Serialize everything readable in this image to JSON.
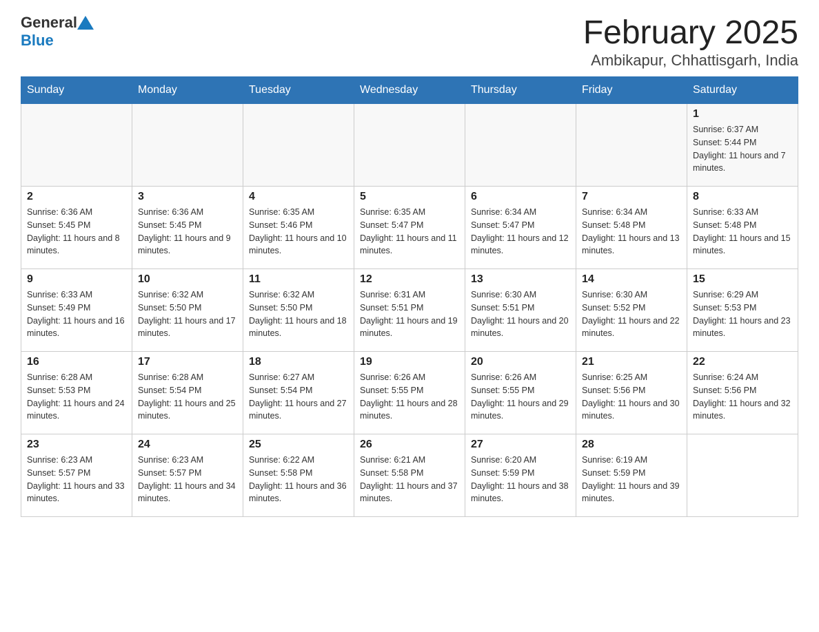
{
  "logo": {
    "general": "General",
    "blue": "Blue"
  },
  "header": {
    "title": "February 2025",
    "location": "Ambikapur, Chhattisgarh, India"
  },
  "weekdays": [
    "Sunday",
    "Monday",
    "Tuesday",
    "Wednesday",
    "Thursday",
    "Friday",
    "Saturday"
  ],
  "weeks": [
    [
      {
        "day": "",
        "info": ""
      },
      {
        "day": "",
        "info": ""
      },
      {
        "day": "",
        "info": ""
      },
      {
        "day": "",
        "info": ""
      },
      {
        "day": "",
        "info": ""
      },
      {
        "day": "",
        "info": ""
      },
      {
        "day": "1",
        "info": "Sunrise: 6:37 AM\nSunset: 5:44 PM\nDaylight: 11 hours and 7 minutes."
      }
    ],
    [
      {
        "day": "2",
        "info": "Sunrise: 6:36 AM\nSunset: 5:45 PM\nDaylight: 11 hours and 8 minutes."
      },
      {
        "day": "3",
        "info": "Sunrise: 6:36 AM\nSunset: 5:45 PM\nDaylight: 11 hours and 9 minutes."
      },
      {
        "day": "4",
        "info": "Sunrise: 6:35 AM\nSunset: 5:46 PM\nDaylight: 11 hours and 10 minutes."
      },
      {
        "day": "5",
        "info": "Sunrise: 6:35 AM\nSunset: 5:47 PM\nDaylight: 11 hours and 11 minutes."
      },
      {
        "day": "6",
        "info": "Sunrise: 6:34 AM\nSunset: 5:47 PM\nDaylight: 11 hours and 12 minutes."
      },
      {
        "day": "7",
        "info": "Sunrise: 6:34 AM\nSunset: 5:48 PM\nDaylight: 11 hours and 13 minutes."
      },
      {
        "day": "8",
        "info": "Sunrise: 6:33 AM\nSunset: 5:48 PM\nDaylight: 11 hours and 15 minutes."
      }
    ],
    [
      {
        "day": "9",
        "info": "Sunrise: 6:33 AM\nSunset: 5:49 PM\nDaylight: 11 hours and 16 minutes."
      },
      {
        "day": "10",
        "info": "Sunrise: 6:32 AM\nSunset: 5:50 PM\nDaylight: 11 hours and 17 minutes."
      },
      {
        "day": "11",
        "info": "Sunrise: 6:32 AM\nSunset: 5:50 PM\nDaylight: 11 hours and 18 minutes."
      },
      {
        "day": "12",
        "info": "Sunrise: 6:31 AM\nSunset: 5:51 PM\nDaylight: 11 hours and 19 minutes."
      },
      {
        "day": "13",
        "info": "Sunrise: 6:30 AM\nSunset: 5:51 PM\nDaylight: 11 hours and 20 minutes."
      },
      {
        "day": "14",
        "info": "Sunrise: 6:30 AM\nSunset: 5:52 PM\nDaylight: 11 hours and 22 minutes."
      },
      {
        "day": "15",
        "info": "Sunrise: 6:29 AM\nSunset: 5:53 PM\nDaylight: 11 hours and 23 minutes."
      }
    ],
    [
      {
        "day": "16",
        "info": "Sunrise: 6:28 AM\nSunset: 5:53 PM\nDaylight: 11 hours and 24 minutes."
      },
      {
        "day": "17",
        "info": "Sunrise: 6:28 AM\nSunset: 5:54 PM\nDaylight: 11 hours and 25 minutes."
      },
      {
        "day": "18",
        "info": "Sunrise: 6:27 AM\nSunset: 5:54 PM\nDaylight: 11 hours and 27 minutes."
      },
      {
        "day": "19",
        "info": "Sunrise: 6:26 AM\nSunset: 5:55 PM\nDaylight: 11 hours and 28 minutes."
      },
      {
        "day": "20",
        "info": "Sunrise: 6:26 AM\nSunset: 5:55 PM\nDaylight: 11 hours and 29 minutes."
      },
      {
        "day": "21",
        "info": "Sunrise: 6:25 AM\nSunset: 5:56 PM\nDaylight: 11 hours and 30 minutes."
      },
      {
        "day": "22",
        "info": "Sunrise: 6:24 AM\nSunset: 5:56 PM\nDaylight: 11 hours and 32 minutes."
      }
    ],
    [
      {
        "day": "23",
        "info": "Sunrise: 6:23 AM\nSunset: 5:57 PM\nDaylight: 11 hours and 33 minutes."
      },
      {
        "day": "24",
        "info": "Sunrise: 6:23 AM\nSunset: 5:57 PM\nDaylight: 11 hours and 34 minutes."
      },
      {
        "day": "25",
        "info": "Sunrise: 6:22 AM\nSunset: 5:58 PM\nDaylight: 11 hours and 36 minutes."
      },
      {
        "day": "26",
        "info": "Sunrise: 6:21 AM\nSunset: 5:58 PM\nDaylight: 11 hours and 37 minutes."
      },
      {
        "day": "27",
        "info": "Sunrise: 6:20 AM\nSunset: 5:59 PM\nDaylight: 11 hours and 38 minutes."
      },
      {
        "day": "28",
        "info": "Sunrise: 6:19 AM\nSunset: 5:59 PM\nDaylight: 11 hours and 39 minutes."
      },
      {
        "day": "",
        "info": ""
      }
    ]
  ]
}
